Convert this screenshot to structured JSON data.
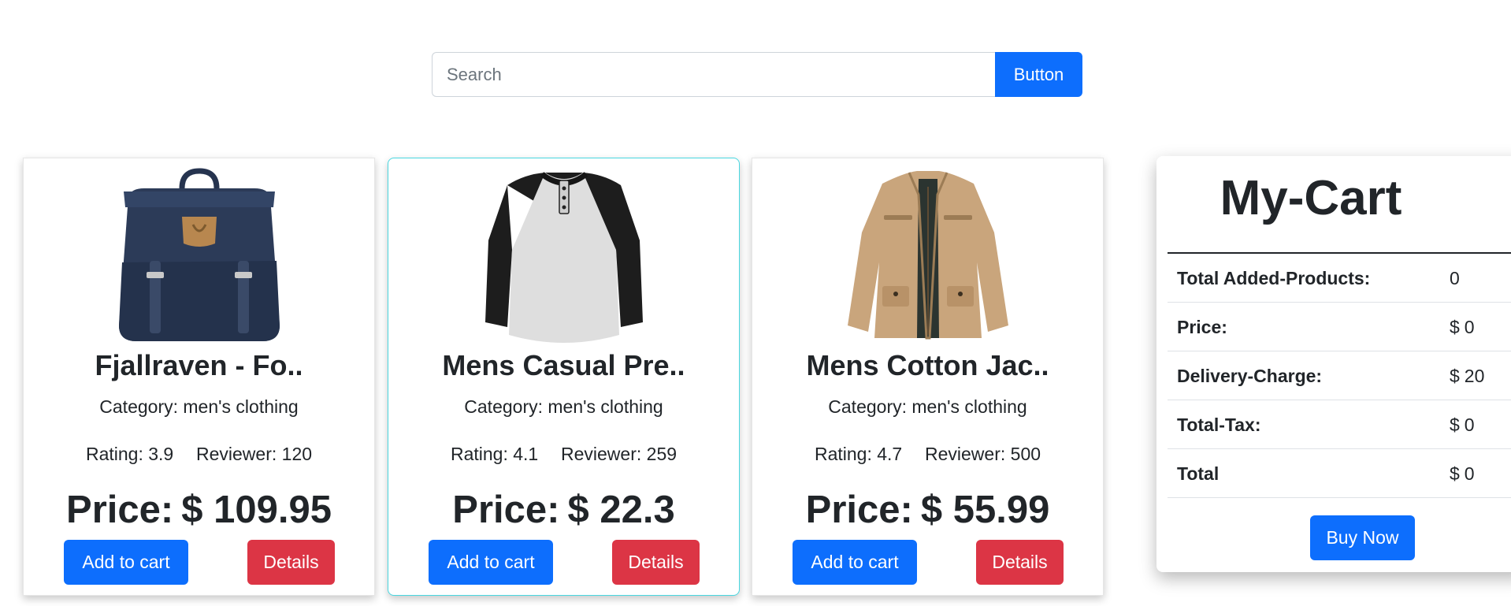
{
  "search": {
    "placeholder": "Search",
    "value": "",
    "button_label": "Button"
  },
  "products": [
    {
      "title": "Fjallraven - Fo..",
      "category_label": "Category:",
      "category": "men's clothing",
      "rating_label": "Rating:",
      "rating": "3.9",
      "reviewer_label": "Reviewer:",
      "reviewers": "120",
      "price_label": "Price:",
      "currency": "$",
      "price": "109.95",
      "add_label": "Add to cart",
      "details_label": "Details",
      "image_icon": "backpack-image"
    },
    {
      "title": "Mens Casual Pre..",
      "category_label": "Category:",
      "category": "men's clothing",
      "rating_label": "Rating:",
      "rating": "4.1",
      "reviewer_label": "Reviewer:",
      "reviewers": "259",
      "price_label": "Price:",
      "currency": "$",
      "price": "22.3",
      "add_label": "Add to cart",
      "details_label": "Details",
      "image_icon": "raglan-tshirt-image"
    },
    {
      "title": "Mens Cotton Jac..",
      "category_label": "Category:",
      "category": "men's clothing",
      "rating_label": "Rating:",
      "rating": "4.7",
      "reviewer_label": "Reviewer:",
      "reviewers": "500",
      "price_label": "Price:",
      "currency": "$",
      "price": "55.99",
      "add_label": "Add to cart",
      "details_label": "Details",
      "image_icon": "cotton-jacket-image"
    }
  ],
  "cart": {
    "title": "My-Cart",
    "rows": [
      {
        "label": "Total Added-Products:",
        "currency": "",
        "value": "0"
      },
      {
        "label": "Price:",
        "currency": "$",
        "value": "0"
      },
      {
        "label": "Delivery-Charge:",
        "currency": "$",
        "value": "20"
      },
      {
        "label": "Total-Tax:",
        "currency": "$",
        "value": "0"
      },
      {
        "label": "Total",
        "currency": "$",
        "value": "0"
      }
    ],
    "buy_label": "Buy Now"
  },
  "colors": {
    "primary": "#0d6efd",
    "danger": "#dc3545",
    "selected_border": "#49d7e0",
    "text": "#212529"
  }
}
